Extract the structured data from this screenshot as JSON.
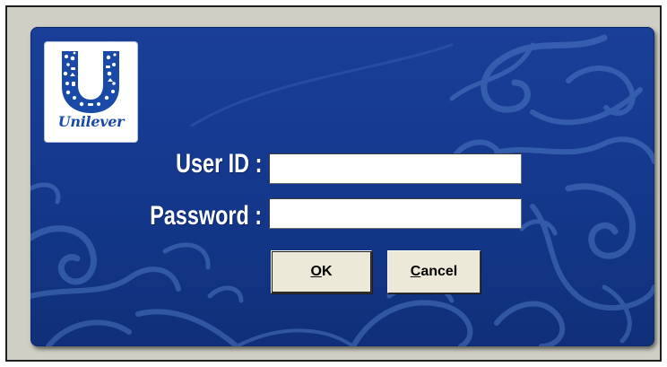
{
  "logo": {
    "wordmark": "Unilever",
    "icon": "unilever-u-logo-icon"
  },
  "form": {
    "user_id_label": "User ID :",
    "user_id_value": "",
    "password_label": "Password :",
    "password_value": ""
  },
  "buttons": {
    "ok": {
      "mnemonic": "O",
      "rest": "K"
    },
    "cancel": {
      "mnemonic": "C",
      "rest": "ancel"
    }
  },
  "colors": {
    "panel_background": "#163a91",
    "swirl": "#5a86cf",
    "logo_blue": "#1a4aa8",
    "label_text": "#ffffff",
    "button_face": "#ece9d8"
  }
}
